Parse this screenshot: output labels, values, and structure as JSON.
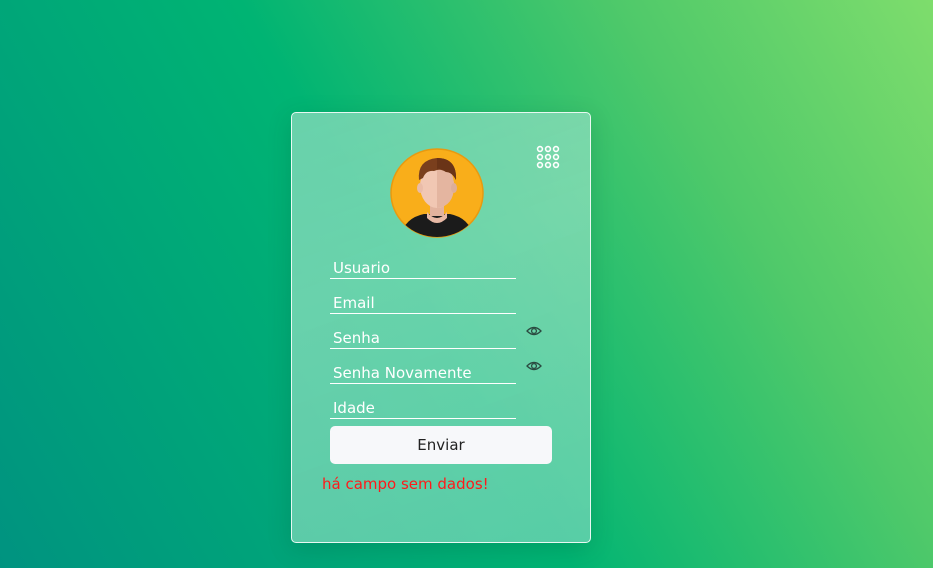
{
  "form": {
    "fields": [
      {
        "name": "usuario",
        "placeholder": "Usuario",
        "value": ""
      },
      {
        "name": "email",
        "placeholder": "Email",
        "value": ""
      },
      {
        "name": "senha",
        "placeholder": "Senha",
        "value": ""
      },
      {
        "name": "senha-novamente",
        "placeholder": "Senha Novamente",
        "value": ""
      },
      {
        "name": "idade",
        "placeholder": "Idade",
        "value": ""
      }
    ],
    "submit_label": "Enviar",
    "error_message": "há campo sem dados!"
  },
  "icons": {
    "avatar": "user-avatar",
    "menu": "apps-grid-icon",
    "reveal_password": "eye-icon"
  },
  "colors": {
    "error": "#ff1a1a",
    "avatar_bg": "#f9ae1a",
    "button_bg": "#f7f8fa"
  }
}
